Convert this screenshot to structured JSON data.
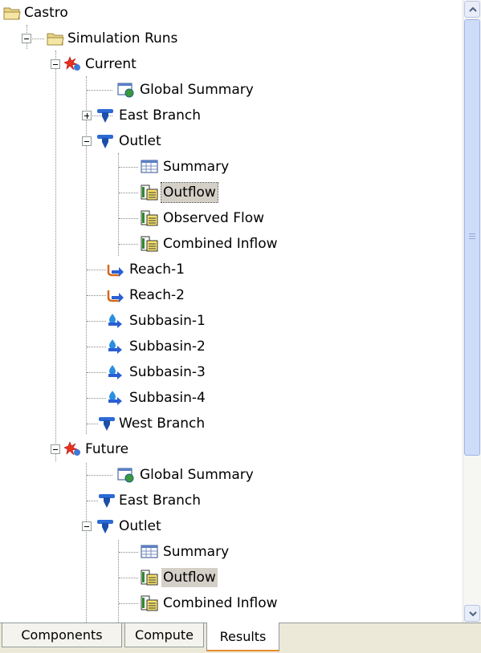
{
  "tree": {
    "nodes": [
      {
        "label": "Castro",
        "icon": "folder-open-icon"
      },
      {
        "label": "Simulation Runs",
        "icon": "folder-open-icon"
      },
      {
        "label": "Current",
        "icon": "simulation-run-icon"
      },
      {
        "label": "Global Summary",
        "icon": "global-summary-icon"
      },
      {
        "label": "East Branch",
        "icon": "junction-icon"
      },
      {
        "label": "Outlet",
        "icon": "junction-icon"
      },
      {
        "label": "Summary",
        "icon": "summary-table-icon"
      },
      {
        "label": "Outflow",
        "icon": "time-series-graph-icon"
      },
      {
        "label": "Observed Flow",
        "icon": "time-series-graph-icon"
      },
      {
        "label": "Combined Inflow",
        "icon": "time-series-graph-icon"
      },
      {
        "label": "Reach-1",
        "icon": "reach-icon"
      },
      {
        "label": "Reach-2",
        "icon": "reach-icon"
      },
      {
        "label": "Subbasin-1",
        "icon": "subbasin-icon"
      },
      {
        "label": "Subbasin-2",
        "icon": "subbasin-icon"
      },
      {
        "label": "Subbasin-3",
        "icon": "subbasin-icon"
      },
      {
        "label": "Subbasin-4",
        "icon": "subbasin-icon"
      },
      {
        "label": "West Branch",
        "icon": "junction-icon"
      },
      {
        "label": "Future",
        "icon": "simulation-run-icon"
      },
      {
        "label": "Global Summary",
        "icon": "global-summary-icon"
      },
      {
        "label": "East Branch",
        "icon": "junction-icon"
      },
      {
        "label": "Outlet",
        "icon": "junction-icon"
      },
      {
        "label": "Summary",
        "icon": "summary-table-icon"
      },
      {
        "label": "Outflow",
        "icon": "time-series-graph-icon"
      },
      {
        "label": "Combined Inflow",
        "icon": "time-series-graph-icon"
      }
    ]
  },
  "tabs": [
    {
      "label": "Components"
    },
    {
      "label": "Compute"
    },
    {
      "label": "Results",
      "active": true
    }
  ],
  "colors": {
    "accent_tab": "#e68b2c",
    "selection": "#d4d0c8"
  }
}
